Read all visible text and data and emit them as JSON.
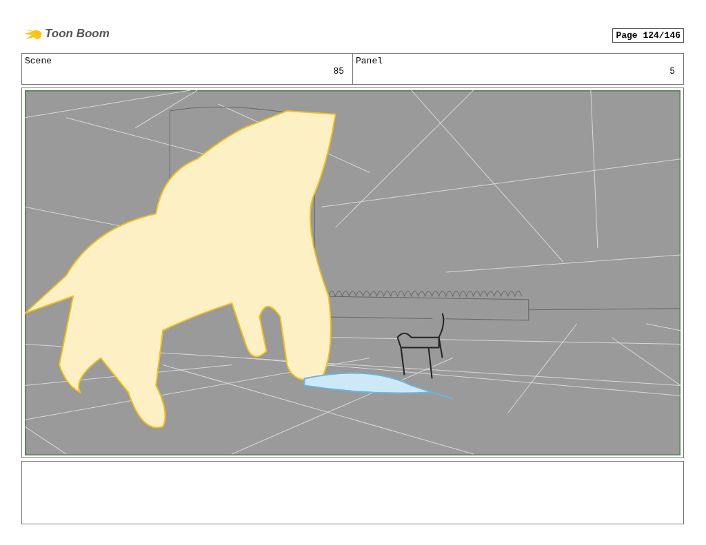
{
  "logo": {
    "text": "Toon Boom"
  },
  "page": {
    "label": "Page 124/146"
  },
  "header": [
    {
      "label": "Scene",
      "value": "85"
    },
    {
      "label": "Panel",
      "value": "5"
    }
  ],
  "panel": {
    "kind": "drawing"
  }
}
